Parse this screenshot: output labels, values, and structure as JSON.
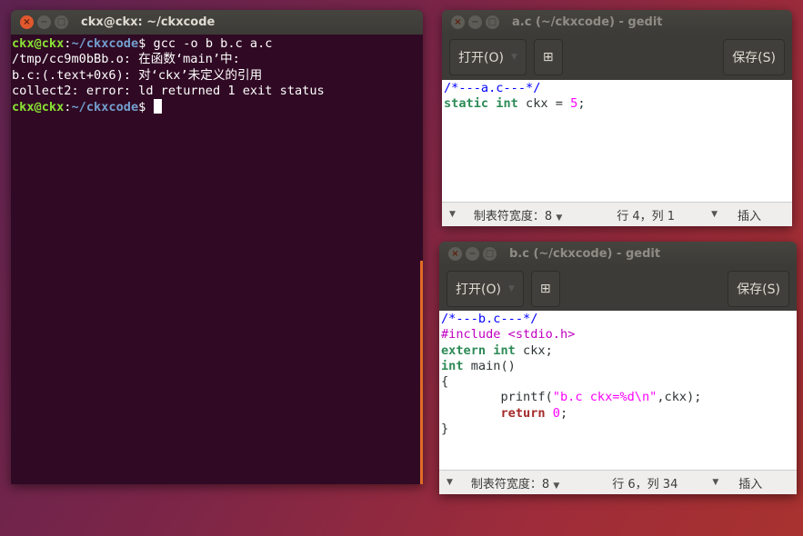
{
  "terminal": {
    "title": "ckx@ckx: ~/ckxcode",
    "lines": [
      {
        "user": "ckx@ckx",
        "path": "~/ckxcode",
        "cmd": " gcc -o b b.c a.c"
      },
      {
        "text": "/tmp/cc9m0bBb.o: 在函数‘main’中:"
      },
      {
        "text": "b.c:(.text+0x6): 对‘ckx’未定义的引用"
      },
      {
        "text": "collect2: error: ld returned 1 exit status"
      },
      {
        "user": "ckx@ckx",
        "path": "~/ckxcode",
        "cmd": " "
      }
    ]
  },
  "gedit_a": {
    "title": "a.c (~/ckxcode) - gedit",
    "open": "打开(O)",
    "save": "保存(S)",
    "code": [
      [
        [
          "/*---a.c---*/",
          "#0000ff",
          0
        ]
      ],
      [
        [
          "static",
          "#2e8b57",
          1
        ],
        [
          " ",
          null,
          0
        ],
        [
          "int",
          "#2e8b57",
          1
        ],
        [
          " ckx = ",
          null,
          0
        ],
        [
          "5",
          "#ff00ff",
          0
        ],
        [
          ";",
          null,
          0
        ]
      ]
    ],
    "status": {
      "tab": "制表符宽度：8",
      "pos": "行 4，列 1",
      "mode": "插入"
    }
  },
  "gedit_b": {
    "title": "b.c (~/ckxcode) - gedit",
    "open": "打开(O)",
    "save": "保存(S)",
    "code": [
      [
        [
          "/*---b.c---*/",
          "#0000ff",
          0
        ]
      ],
      [
        [
          "#include <stdio.h>",
          "#c000c0",
          0
        ]
      ],
      [
        [
          "extern",
          "#2e8b57",
          1
        ],
        [
          " ",
          null,
          0
        ],
        [
          "int",
          "#2e8b57",
          1
        ],
        [
          " ckx;",
          null,
          0
        ]
      ],
      [
        [
          "int",
          "#2e8b57",
          1
        ],
        [
          " main()",
          null,
          0
        ]
      ],
      [
        [
          "{",
          null,
          0
        ]
      ],
      [
        [
          "\tprintf(",
          null,
          0
        ],
        [
          "\"b.c ckx=%d\\n\"",
          "#ff00ff",
          0
        ],
        [
          ",ckx);",
          null,
          0
        ]
      ],
      [
        [
          "\t",
          null,
          0
        ],
        [
          "return",
          "#a52a2a",
          1
        ],
        [
          " ",
          null,
          0
        ],
        [
          "0",
          "#ff00ff",
          0
        ],
        [
          ";",
          null,
          0
        ]
      ],
      [
        [
          "}",
          null,
          0
        ]
      ]
    ],
    "status": {
      "tab": "制表符宽度：8",
      "pos": "行 6，列 34",
      "mode": "插入"
    }
  }
}
